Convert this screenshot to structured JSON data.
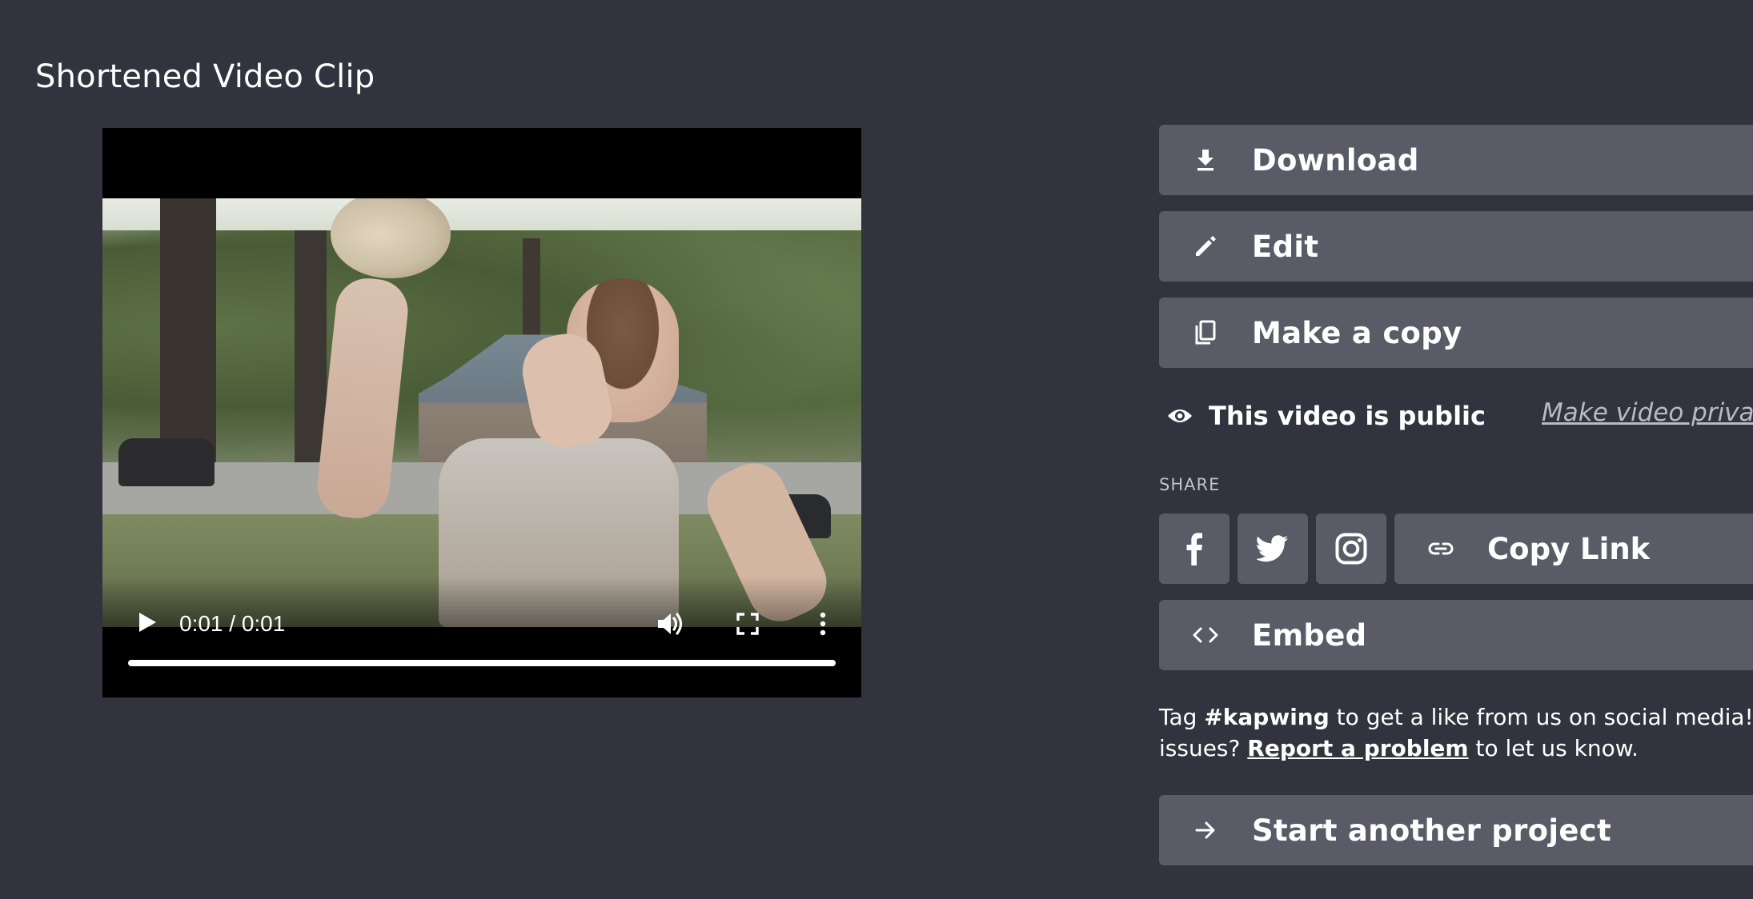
{
  "page": {
    "title": "Shortened Video Clip"
  },
  "player": {
    "time": "0:01 / 0:01",
    "progress_fraction": 1.0,
    "icons": [
      "play-icon",
      "volume-icon",
      "fullscreen-icon",
      "more-vertical-icon"
    ]
  },
  "actions": {
    "download_label": "Download",
    "edit_label": "Edit",
    "copy_label": "Make a copy",
    "embed_label": "Embed",
    "start_project_label": "Start another project"
  },
  "visibility": {
    "status": "This video is public",
    "toggle_link": "Make video private"
  },
  "share": {
    "heading": "SHARE",
    "networks": [
      "facebook",
      "twitter",
      "instagram"
    ],
    "copy_link_label": "Copy Link"
  },
  "footer_note": {
    "prefix": "Tag ",
    "hashtag": "#kapwing",
    "middle": " to get a like from us on social media! Any",
    "line2_prefix": "issues? ",
    "report_link": "Report a problem",
    "suffix": " to let us know."
  },
  "colors": {
    "background": "#32333e",
    "button": "#5a5b66",
    "text": "#ffffff",
    "muted_text": "#b9bac4"
  }
}
